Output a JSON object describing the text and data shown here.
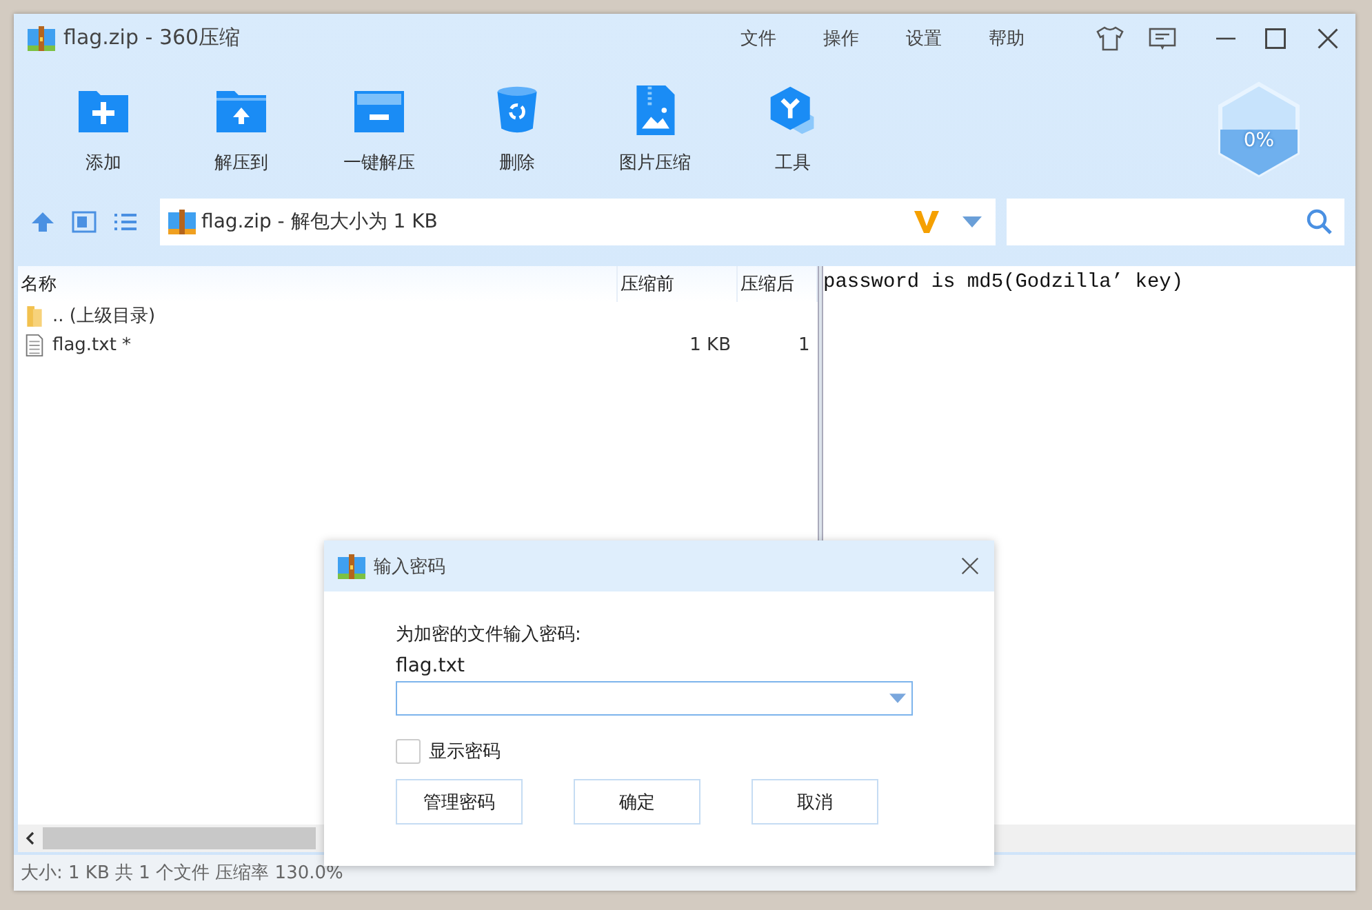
{
  "window": {
    "title": "flag.zip - 360压缩",
    "menu": [
      "文件",
      "操作",
      "设置",
      "帮助"
    ]
  },
  "toolbar": [
    {
      "kind": "add",
      "label": "添加"
    },
    {
      "kind": "extract",
      "label": "解压到"
    },
    {
      "kind": "oneclick",
      "label": "一键解压"
    },
    {
      "kind": "delete",
      "label": "删除"
    },
    {
      "kind": "image",
      "label": "图片压缩"
    },
    {
      "kind": "tools",
      "label": "工具"
    }
  ],
  "progress": {
    "text": "0%"
  },
  "address": {
    "text": "flag.zip - 解包大小为 1 KB"
  },
  "file_list": {
    "columns": [
      "名称",
      "压缩前",
      "压缩后"
    ],
    "rows": [
      {
        "kind": "folder",
        "name": ".. (上级目录)"
      },
      {
        "kind": "file",
        "name": "flag.txt *",
        "size": "1 KB",
        "packed": "1"
      }
    ]
  },
  "preview": {
    "text": "password is md5(Godzilla’ key)"
  },
  "status_bar": "大小: 1 KB 共 1 个文件 压缩率 130.0%",
  "dialog": {
    "title": "输入密码",
    "prompt": "为加密的文件输入密码:",
    "file": "flag.txt",
    "show_password": {
      "label": "显示密码",
      "checked": false
    },
    "buttons": [
      "管理密码",
      "确定",
      "取消"
    ]
  }
}
